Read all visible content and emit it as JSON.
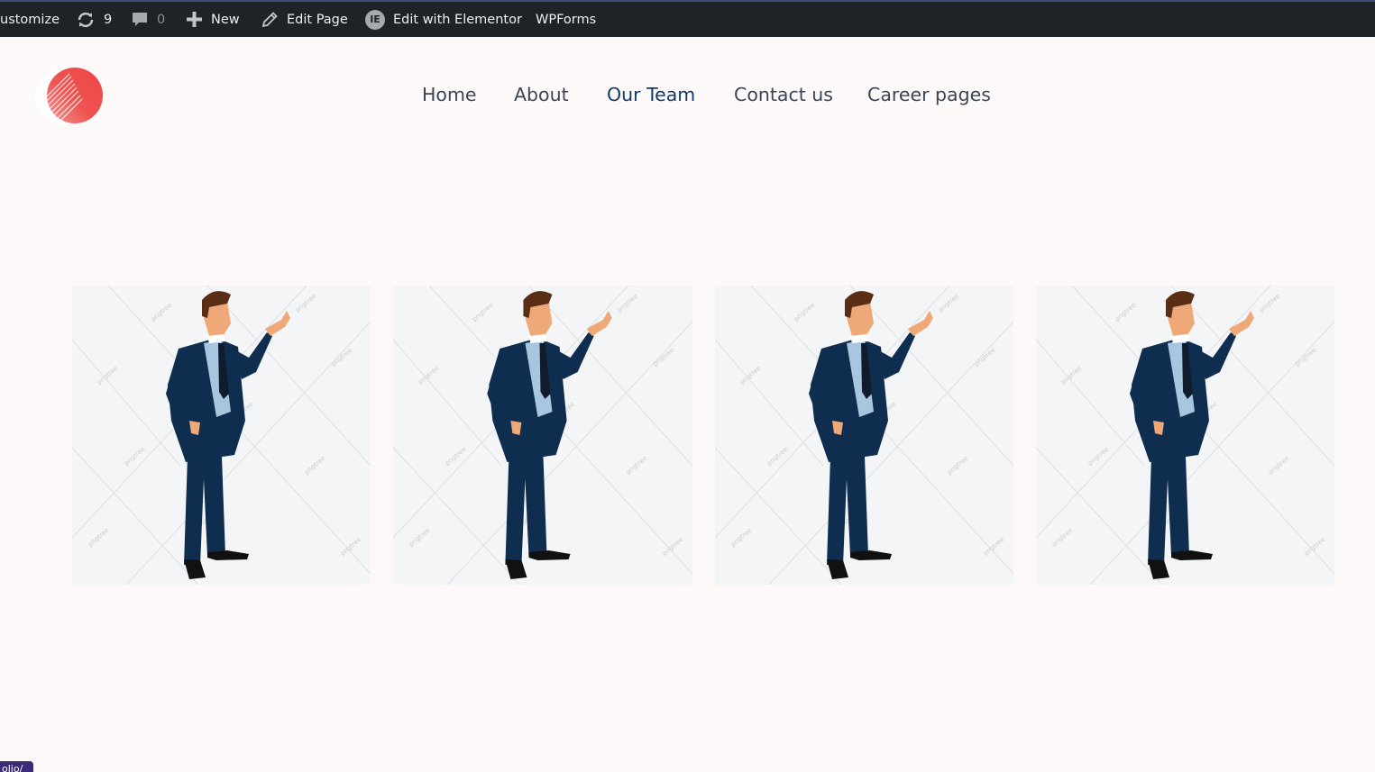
{
  "adminbar": {
    "customize": "ustomize",
    "updates_count": "9",
    "comments_count": "0",
    "new_label": "New",
    "edit_page_label": "Edit Page",
    "elementor_label": "Edit with Elementor",
    "wpforms_label": "WPForms",
    "icons": [
      "refresh-icon",
      "comment-icon",
      "plus-icon",
      "pencil-icon",
      "elementor-icon"
    ],
    "elementor_badge": "IE"
  },
  "header": {
    "logo": "logo",
    "nav": [
      {
        "label": "Home"
      },
      {
        "label": "About"
      },
      {
        "label": "Our Team",
        "active": true
      },
      {
        "label": "Contact us"
      },
      {
        "label": "Career pages"
      }
    ]
  },
  "team": {
    "cards": [
      {
        "image": "businessman-illustration",
        "watermark": "pngtree"
      },
      {
        "image": "businessman-illustration",
        "watermark": "pngtree"
      },
      {
        "image": "businessman-illustration",
        "watermark": "pngtree"
      },
      {
        "image": "businessman-illustration",
        "watermark": "pngtree"
      }
    ]
  },
  "footer_tab": {
    "text": "olio/"
  },
  "colors": {
    "adminbar_bg": "#1d2327",
    "page_bg": "#fdf9f9",
    "nav_text": "#3c4556",
    "nav_active": "#123b67",
    "logo_red": "#ef4b4b",
    "suit_navy": "#0f2d4f"
  }
}
